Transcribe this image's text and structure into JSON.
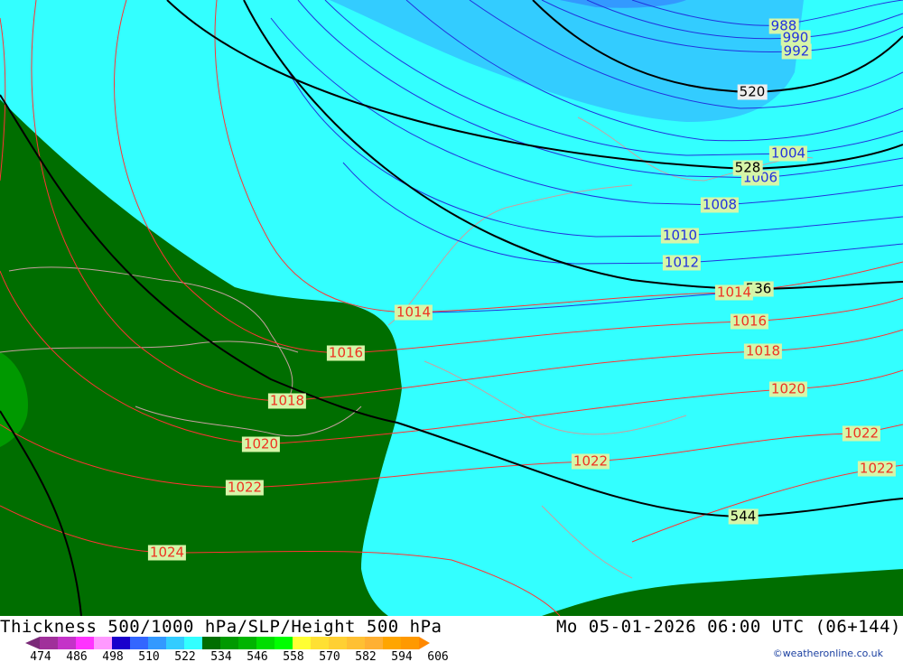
{
  "title": "Thickness 500/1000 hPa/SLP/Height 500 hPa",
  "datetime": "Mo 05-01-2026 06:00 UTC (06+144)",
  "copyright": "©weatheronline.co.uk",
  "colors": {
    "cyan": "#33ffff",
    "mid_blue": "#33ccff",
    "dark_blue": "#3399ff",
    "dark_green": "#006e00",
    "green": "#009900",
    "isobar": "#2233dd",
    "isotherm_red": "#ff3333",
    "height": "#000000"
  },
  "legend": {
    "ticks": [
      "474",
      "486",
      "498",
      "510",
      "522",
      "534",
      "546",
      "558",
      "570",
      "582",
      "594",
      "606"
    ],
    "colors": [
      "#a0309a",
      "#c433c8",
      "#ff33ff",
      "#ff99ff",
      "#1a00cc",
      "#3366ff",
      "#3399ff",
      "#33ccff",
      "#33ffff",
      "#006e00",
      "#009900",
      "#00b400",
      "#00dd00",
      "#00ff00",
      "#ffff33",
      "#ffe033",
      "#ffd033",
      "#ffc033",
      "#ffb033",
      "#ffa500",
      "#ff9900"
    ]
  },
  "isobar_labels": [
    "988",
    "990",
    "992",
    "1004",
    "1006",
    "1008",
    "1010",
    "1012"
  ],
  "slp_labels": [
    "1014",
    "1014",
    "1016",
    "1016",
    "1018",
    "1018",
    "1020",
    "1020",
    "1022",
    "1022",
    "1022",
    "1022",
    "1024"
  ],
  "height_labels": [
    "520",
    "528",
    "536",
    "544"
  ]
}
